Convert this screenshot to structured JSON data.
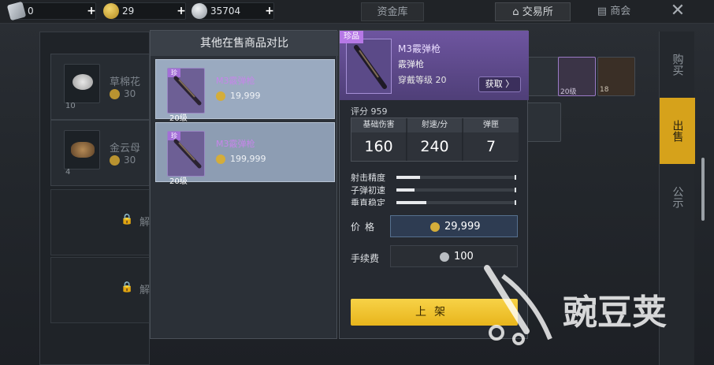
{
  "topbar": {
    "currency": [
      {
        "icon": "voucher-icon",
        "value": "0"
      },
      {
        "icon": "gold-coin-icon",
        "value": "29"
      },
      {
        "icon": "silver-coin-icon",
        "value": "35704"
      }
    ],
    "vault_label": "资金库",
    "exchange_label": "交易所",
    "shop_label": "商会"
  },
  "left_list": {
    "items": [
      {
        "name": "草棉花",
        "price": "30",
        "qty": "10"
      },
      {
        "name": "金云母",
        "price": "30",
        "qty": "4"
      }
    ],
    "locked_label": "解"
  },
  "side_tabs": [
    {
      "label": "购买",
      "active": false
    },
    {
      "label": "出售",
      "active": true
    },
    {
      "label": "公示",
      "active": false
    }
  ],
  "market_grid": {
    "labels": [
      "20级",
      "18"
    ]
  },
  "compare": {
    "title": "其他在售商品对比",
    "cards": [
      {
        "rarity": "珍",
        "name": "M3霰弹枪",
        "price": "19,999",
        "level": "20级"
      },
      {
        "rarity": "珍",
        "name": "M3霰弹枪",
        "price": "199,999",
        "level": "20级"
      }
    ]
  },
  "detail": {
    "rarity": "珍品",
    "name": "M3霰弹枪",
    "type": "霰弹枪",
    "equip_level": "穿戴等级 20",
    "get_label": "获取 〉",
    "score": "评分 959",
    "stats_headers": [
      "基础伤害",
      "射速/分",
      "弹匣"
    ],
    "stats_values": [
      "160",
      "240",
      "7"
    ],
    "bars": [
      {
        "label": "射击精度",
        "value": 0.2
      },
      {
        "label": "子弹初速",
        "value": 0.15
      },
      {
        "label": "垂直稳定",
        "value": 0.25
      }
    ],
    "price_label": "价格",
    "price_value": "29,999",
    "fee_label": "手续费",
    "fee_value": "100",
    "list_button": "上架"
  },
  "watermark": "豌豆荚",
  "colors": {
    "accent_gold": "#e8b51c",
    "rare_purple": "#b678e6",
    "active_tab": "#d6a21b"
  }
}
